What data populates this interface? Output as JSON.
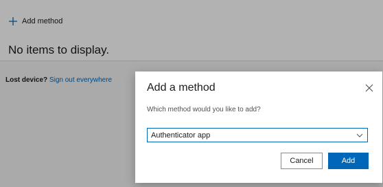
{
  "toolbar": {
    "add_method_label": "Add method",
    "add_icon": "plus-icon"
  },
  "list": {
    "empty_message": "No items to display."
  },
  "lost_device": {
    "question": "Lost device?",
    "link_label": "Sign out everywhere"
  },
  "dialog": {
    "title": "Add a method",
    "close_icon": "close-icon",
    "prompt": "Which method would you like to add?",
    "select": {
      "selected_value": "Authenticator app",
      "chevron_icon": "chevron-down-icon"
    },
    "cancel_label": "Cancel",
    "add_label": "Add"
  },
  "colors": {
    "accent": "#0067b8",
    "overlay": "rgba(0,0,0,0.30)"
  }
}
